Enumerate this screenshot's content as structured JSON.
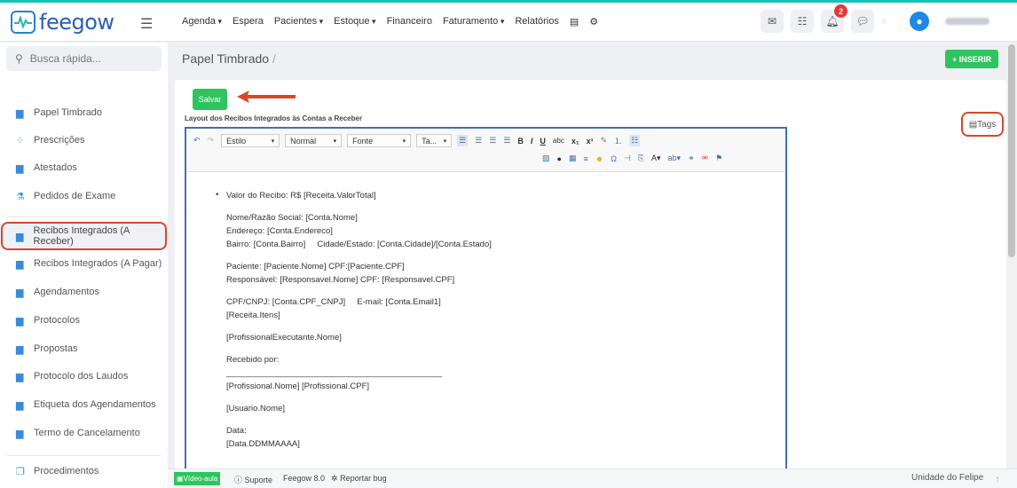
{
  "brand": {
    "name": "feegow"
  },
  "nav": {
    "items": [
      {
        "label": "Agenda",
        "caret": true
      },
      {
        "label": "Espera",
        "caret": false
      },
      {
        "label": "Pacientes",
        "caret": true
      },
      {
        "label": "Estoque",
        "caret": true
      },
      {
        "label": "Financeiro",
        "caret": false
      },
      {
        "label": "Faturamento",
        "caret": true
      },
      {
        "label": "Relatórios",
        "caret": false
      }
    ],
    "notification_count": "2"
  },
  "sidebar": {
    "search_placeholder": "Busca rápida...",
    "items": [
      {
        "label": "Papel Timbrado",
        "icon": "document-icon"
      },
      {
        "label": "Prescrições",
        "icon": "pills-icon"
      },
      {
        "label": "Atestados",
        "icon": "document-icon"
      },
      {
        "label": "Pedidos de Exame",
        "icon": "flask-icon"
      },
      {
        "label": "Recibos Integrados (A Receber)",
        "icon": "document-icon",
        "active": true
      },
      {
        "label": "Recibos Integrados (A Pagar)",
        "icon": "document-icon"
      },
      {
        "label": "Agendamentos",
        "icon": "document-icon"
      },
      {
        "label": "Protocolos",
        "icon": "document-icon"
      },
      {
        "label": "Propostas",
        "icon": "document-icon"
      },
      {
        "label": "Protocolo dos Laudos",
        "icon": "document-icon"
      },
      {
        "label": "Etiqueta dos Agendamentos",
        "icon": "document-icon"
      },
      {
        "label": "Termo de Cancelamento",
        "icon": "document-icon"
      },
      {
        "label": "Procedimentos",
        "icon": "copy-icon"
      }
    ]
  },
  "header": {
    "title": "Papel Timbrado",
    "separator": "/",
    "insert_label": "+ INSERIR"
  },
  "panel": {
    "save_label": "Salvar",
    "layout_label": "Layout dos Recibos Integrados às Contas a Receber",
    "tags_label": "Tags"
  },
  "toolbar": {
    "style_label": "Estilo",
    "format_label": "Normal",
    "font_label": "Fonte",
    "size_label": "Ta...",
    "bold": "B",
    "italic": "I",
    "underline": "U",
    "strike": "abc",
    "sub": "x₁",
    "sup": "x¹"
  },
  "editor": {
    "lines": [
      "Valor do Recibo: R$ [Receita.ValorTotal]",
      "",
      "Nome/Razão Social: [Conta.Nome]",
      "Endereço: [Conta.Endereco]",
      "Bairro: [Conta.Bairro]     Cidade/Estado: [Conta.Cidade]/[Conta.Estado]",
      "",
      "Paciente: [Paciente.Nome] CPF:[Paciente.CPF]",
      "Responsável: [Responsavel.Nome] CPF: [Responsavel.CPF]",
      "",
      "CPF/CNPJ: [Conta.CPF_CNPJ]     E-mail: [Conta.Email1]",
      "[Receita.Itens]",
      "",
      "[ProfissionalExecutante.Nome]",
      "",
      "Recebido por:",
      "______________________________________________",
      "[Profissional.Nome] [Profissional.CPF]",
      "",
      "[Usuario.Nome]",
      "",
      "Data:",
      "[Data.DDMMAAAA]"
    ]
  },
  "footer": {
    "video_label": "Vídeo-aula",
    "support_label": "Suporte",
    "version_label": "Feegow 8.0",
    "bug_label": "Reportar bug",
    "unit_label": "Unidade do Felipe"
  }
}
